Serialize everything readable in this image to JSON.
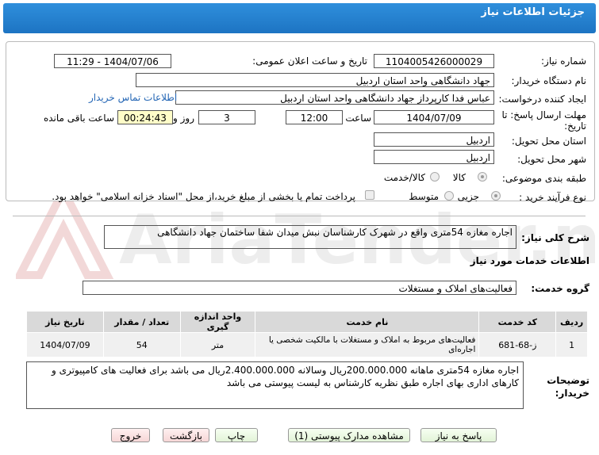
{
  "header": {
    "title": "جزئیات اطلاعات نیاز"
  },
  "form": {
    "need_number_label": "شماره نیاز:",
    "need_number": "1104005426000029",
    "announce_label": "تاریخ و ساعت اعلان عمومی:",
    "announce_value": "1404/07/06 - 11:29",
    "buyer_label": "نام دستگاه خریدار:",
    "buyer_value": "جهاد دانشگاهی واحد استان اردبیل",
    "creator_label": "ایجاد کننده درخواست:",
    "creator_value": "عباس فدا کارپرداز جهاد دانشگاهی واحد استان اردبیل",
    "contact_link": "اطلاعات تماس خریدار",
    "deadline_label_1": "مهلت ارسال پاسخ: تا",
    "deadline_label_2": "تاریخ:",
    "deadline_date": "1404/07/09",
    "time_label": "ساعت",
    "deadline_time": "12:00",
    "days_value": "3",
    "days_label": "روز و",
    "remaining_time": "00:24:43",
    "remaining_label": "ساعت باقی مانده",
    "province_label": "استان محل تحویل:",
    "province_value": "اردبیل",
    "city_label": "شهر محل تحویل:",
    "city_value": "اردبیل",
    "category_label": "طبقه بندی موضوعی:",
    "category_options": [
      "کالا",
      "کالا/خدمت"
    ],
    "process_label": "نوع فرآیند خرید :",
    "process_options": [
      "جزیی",
      "متوسط"
    ],
    "payment_note": "پرداخت تمام یا بخشی از مبلغ خرید،از محل \"اسناد خزانه اسلامی\" خواهد بود."
  },
  "summary": {
    "label": "شرح کلی نیاز:",
    "value": "اجاره مغازه 54متری واقع در شهرک کارشناسان نبش میدان شفا ساختمان جهاد دانشگاهی"
  },
  "services": {
    "heading": "اطلاعات خدمات مورد نیاز",
    "group_label": "گروه خدمت:",
    "group_value": "فعالیت‌های  املاک و مستغلات"
  },
  "table": {
    "headers": [
      "ردیف",
      "کد خدمت",
      "نام خدمت",
      "واحد اندازه گیری",
      "تعداد / مقدار",
      "تاریخ نیاز"
    ],
    "rows": [
      [
        "1",
        "ز-68-681",
        "فعالیت‌های مربوط به املاک و مستغلات با مالکیت شخصی یا اجاره‌ای",
        "متر",
        "54",
        "1404/07/09"
      ]
    ]
  },
  "buyer_notes": {
    "label_1": "توضیحات",
    "label_2": "خریدار:",
    "value": "اجاره مغازه 54متری ماهانه 200.000.000ریال وسالانه 2.400.000.000ریال می باشد برای فعالیت های کامپیوتری و کارهای اداری بهای اجاره طبق نظریه کارشناس به لیست پیوستی می باشد"
  },
  "buttons": {
    "reply": "پاسخ به نیاز",
    "attachments": "مشاهده مدارک پیوستی (1)",
    "print": "چاپ",
    "back": "بازگشت",
    "exit": "خروج"
  },
  "watermark": {
    "text": "AriaTender.net"
  },
  "colors": {
    "header": "#1d74c3",
    "highlight": "#fffdc8",
    "button": "#e2f3d7",
    "button_pink": "#f6d6d6",
    "link": "#2466b5"
  }
}
